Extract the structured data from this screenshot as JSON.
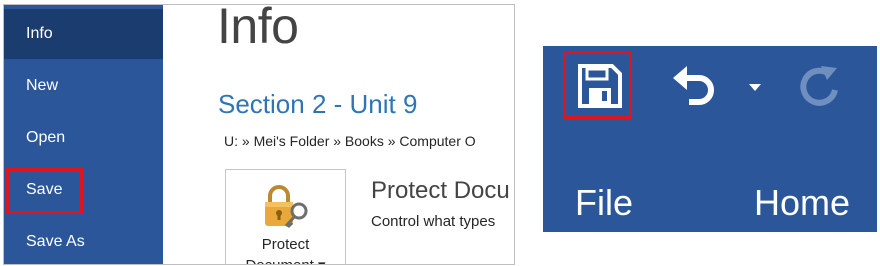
{
  "backstage": {
    "nav": [
      {
        "label": "Info"
      },
      {
        "label": "New"
      },
      {
        "label": "Open"
      },
      {
        "label": "Save"
      },
      {
        "label": "Save As"
      }
    ],
    "title": "Info",
    "doc_title": "Section 2 - Unit 9",
    "doc_path": "U: » Mei's Folder » Books » Computer O",
    "protect": {
      "button_label_line1": "Protect",
      "button_label_line2": "Document ▾",
      "heading": "Protect Docu",
      "description": "Control what types"
    }
  },
  "ribbon": {
    "tabs": [
      {
        "label": "File"
      },
      {
        "label": "Home"
      }
    ],
    "qat": {
      "save_icon": "save-icon",
      "undo_icon": "undo-icon",
      "undo_dropdown_icon": "chevron-down-icon",
      "redo_icon": "redo-icon"
    }
  },
  "colors": {
    "ribbon_blue": "#2b579a",
    "nav_selected": "#1a3c6e",
    "highlight_red": "#e0141e",
    "doc_title_blue": "#2e75b6",
    "lock_gold": "#e9a83a"
  }
}
